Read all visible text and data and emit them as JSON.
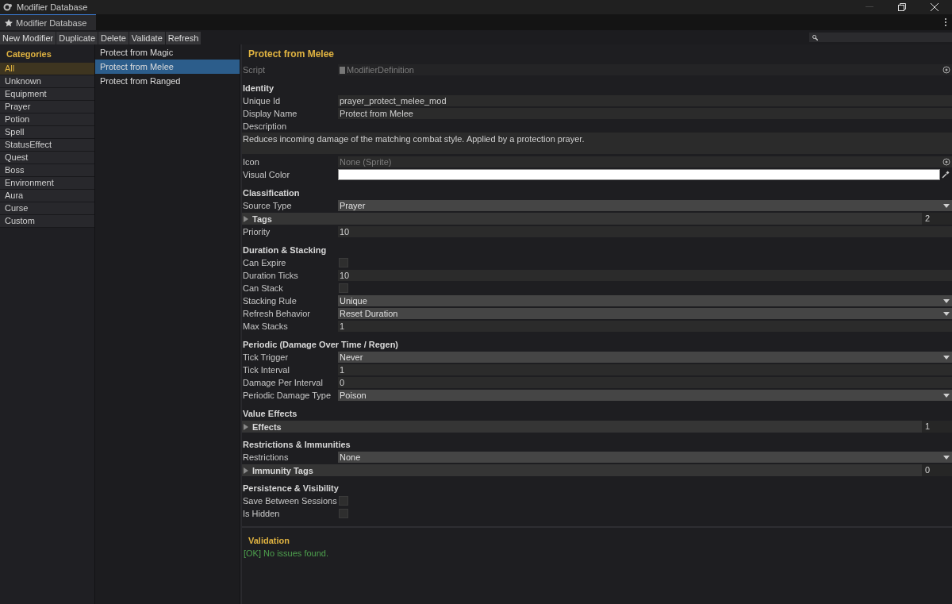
{
  "window": {
    "title": "Modifier Database"
  },
  "tab": {
    "label": "Modifier Database",
    "selected": true
  },
  "toolbar": [
    "New Modifier",
    "Duplicate",
    "Delete",
    "Validate",
    "Refresh"
  ],
  "categories": {
    "title": "Categories",
    "items": [
      {
        "label": "All",
        "selected": true
      },
      {
        "label": "Unknown",
        "selected": false
      },
      {
        "label": "Equipment",
        "selected": false
      },
      {
        "label": "Prayer",
        "selected": false
      },
      {
        "label": "Potion",
        "selected": false
      },
      {
        "label": "Spell",
        "selected": false
      },
      {
        "label": "StatusEffect",
        "selected": false
      },
      {
        "label": "Quest",
        "selected": false
      },
      {
        "label": "Boss",
        "selected": false
      },
      {
        "label": "Environment",
        "selected": false
      },
      {
        "label": "Aura",
        "selected": false
      },
      {
        "label": "Curse",
        "selected": false
      },
      {
        "label": "Custom",
        "selected": false
      }
    ]
  },
  "modifiers": [
    {
      "label": "Protect from Magic",
      "selected": false
    },
    {
      "label": "Protect from Melee",
      "selected": true
    },
    {
      "label": "Protect from Ranged",
      "selected": false
    }
  ],
  "inspector": {
    "title": "Protect from Melee",
    "script": {
      "label": "Script",
      "value": "ModifierDefinition"
    },
    "sections": [
      {
        "title": "Identity",
        "fields": [
          {
            "kind": "text",
            "label": "Unique Id",
            "value": "prayer_protect_melee_mod"
          },
          {
            "kind": "text",
            "label": "Display Name",
            "value": "Protect from Melee"
          },
          {
            "kind": "textarea",
            "label": "Description",
            "value": "Reduces incoming damage of the matching combat style. Applied by a protection prayer."
          },
          {
            "kind": "object",
            "label": "Icon",
            "value": "None (Sprite)"
          },
          {
            "kind": "color",
            "label": "Visual Color",
            "color": "#ffffff"
          }
        ]
      },
      {
        "title": "Classification",
        "fields": [
          {
            "kind": "dropdown",
            "label": "Source Type",
            "value": "Prayer"
          },
          {
            "kind": "foldout",
            "label": "Tags",
            "expanded": false,
            "count": "2"
          },
          {
            "kind": "text",
            "label": "Priority",
            "value": "10"
          }
        ]
      },
      {
        "title": "Duration & Stacking",
        "fields": [
          {
            "kind": "checkbox",
            "label": "Can Expire",
            "checked": false
          },
          {
            "kind": "text",
            "label": "Duration Ticks",
            "value": "10"
          },
          {
            "kind": "checkbox",
            "label": "Can Stack",
            "checked": false
          },
          {
            "kind": "dropdown",
            "label": "Stacking Rule",
            "value": "Unique"
          },
          {
            "kind": "dropdown",
            "label": "Refresh Behavior",
            "value": "Reset Duration"
          },
          {
            "kind": "text",
            "label": "Max Stacks",
            "value": "1"
          }
        ]
      },
      {
        "title": "Periodic (Damage Over Time / Regen)",
        "fields": [
          {
            "kind": "dropdown",
            "label": "Tick Trigger",
            "value": "Never"
          },
          {
            "kind": "text",
            "label": "Tick Interval",
            "value": "1"
          },
          {
            "kind": "text",
            "label": "Damage Per Interval",
            "value": "0"
          },
          {
            "kind": "dropdown",
            "label": "Periodic Damage Type",
            "value": "Poison"
          }
        ]
      },
      {
        "title": "Value Effects",
        "fields": [
          {
            "kind": "foldout",
            "label": "Effects",
            "expanded": false,
            "count": "1"
          }
        ]
      },
      {
        "title": "Restrictions & Immunities",
        "fields": [
          {
            "kind": "dropdown",
            "label": "Restrictions",
            "value": "None"
          },
          {
            "kind": "foldout",
            "label": "Immunity Tags",
            "expanded": false,
            "count": "0"
          }
        ]
      },
      {
        "title": "Persistence & Visibility",
        "fields": [
          {
            "kind": "checkbox",
            "label": "Save Between Sessions",
            "checked": false
          },
          {
            "kind": "checkbox",
            "label": "Is Hidden",
            "checked": false
          }
        ]
      }
    ]
  },
  "validation": {
    "title": "Validation",
    "message": "[OK] No issues found."
  }
}
